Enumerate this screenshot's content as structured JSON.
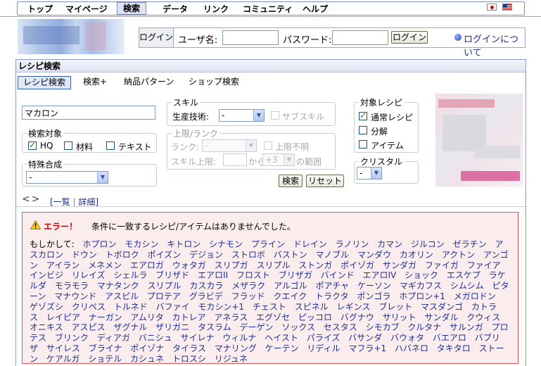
{
  "nav": {
    "items": [
      "トップ",
      "マイページ",
      "検索",
      "データ",
      "リンク",
      "コミュニティ",
      "ヘルプ"
    ],
    "active": "検索"
  },
  "login": {
    "tag": "ログイン",
    "username_label": "ユーザ名:",
    "password_label": "パスワード:",
    "button": "ログイン",
    "about": "ログインについて"
  },
  "panel": {
    "title": "レシピ検索",
    "tabs": [
      "レシピ検索",
      "検索+",
      "納品パターン",
      "ショップ検索"
    ],
    "active_tab": "レシピ検索"
  },
  "search": {
    "keyword": "マカロン",
    "target_legend": "検索対象",
    "targets": [
      {
        "label": "HQ",
        "checked": true
      },
      {
        "label": "材料",
        "checked": false
      },
      {
        "label": "テキスト",
        "checked": false
      }
    ],
    "special_legend": "特殊合成",
    "special_value": "-"
  },
  "skill": {
    "legend": "スキル",
    "tech_label": "生産技術:",
    "tech_value": "-",
    "subskill_label": "サブスキル"
  },
  "limit": {
    "legend": "上限/ランク",
    "rank_label": "ランク:",
    "rank_value": "-",
    "unknown_label": "上限不明",
    "skill_cap_label": "スキル上限:",
    "from_label": "から",
    "range_value": "+3",
    "range_label": "の範囲"
  },
  "actions": {
    "search": "検索",
    "reset": "リセット"
  },
  "recipe_type": {
    "legend": "対象レシピ",
    "items": [
      {
        "label": "通常レシピ",
        "checked": true
      },
      {
        "label": "分解",
        "checked": false
      },
      {
        "label": "アイテム",
        "checked": false
      }
    ]
  },
  "crystal": {
    "legend": "クリスタル",
    "value": "-"
  },
  "pager": {
    "arrows": "<>",
    "list": "[一覧",
    "sep": "|",
    "detail": "詳細]"
  },
  "error": {
    "title": "エラー！",
    "message": "条件に一致するレシピ/アイテムはありませんでした。",
    "maybe": "もしかして:",
    "suggestions": [
      "ホプロン",
      "モカシン",
      "キトロン",
      "シナモン",
      "プライン",
      "ドレイン",
      "ラノリン",
      "カマン",
      "ジルコン",
      "ゼラチン",
      "アスカロン",
      "ドウン",
      "トボロク",
      "ポイズン",
      "デジョン",
      "ストロボ",
      "バストン",
      "マノブル",
      "マンダウ",
      "カオリン",
      "アクトン",
      "アンゴン",
      "アイラン",
      "メネメン",
      "エアロガ",
      "ウォタガ",
      "スリプガ",
      "スリプル",
      "ストンガ",
      "ポイゾガ",
      "サンダガ",
      "ファイガ",
      "ファイア",
      "インビジ",
      "リレイズ",
      "シェルラ",
      "ブリザド",
      "エアロII",
      "フロスト",
      "ブリザガ",
      "バインド",
      "エアロIV",
      "ショック",
      "エスケプ",
      "ラケルダ",
      "モラモラ",
      "マナタンク",
      "スリプル",
      "カスカラ",
      "メザラク",
      "アルゴル",
      "ポアチャ",
      "ケーソン",
      "マギカフス",
      "シムシム",
      "ピターン",
      "マナウンド",
      "アスピル",
      "プロテア",
      "グラビデ",
      "フラッド",
      "クエイク",
      "トラクタ",
      "ポンゴラ",
      "ホプロン+1",
      "メガロドン",
      "ゲゾズシ",
      "クリペス",
      "トルネド",
      "バファイ",
      "モカシン+1",
      "チェスト",
      "スピネル",
      "レギンス",
      "ブレット",
      "マスダンゴ",
      "カトラス",
      "レイピア",
      "ナーガン",
      "アムリタ",
      "カトレア",
      "アネラス",
      "エグゾセ",
      "ピッコロ",
      "バグナウ",
      "サリット",
      "サンダル",
      "クウィス",
      "オニキス",
      "アスピス",
      "ザグナル",
      "ザリガニ",
      "タスラム",
      "デーゲン",
      "ソックス",
      "セスタス",
      "シモカブ",
      "クルタナ",
      "サルンガ",
      "プロテス",
      "ブリンク",
      "ディアガ",
      "バニシュ",
      "サイレナ",
      "ウィルナ",
      "ヘイスト",
      "パライズ",
      "バサンダ",
      "バウォタ",
      "バエアロ",
      "バブリザ",
      "サイレス",
      "ブライナ",
      "ポイゾナ",
      "タイラス",
      "マナリング",
      "ケーテン",
      "リディル",
      "マフラ+1",
      "ハバネロ",
      "タキタロ",
      "ストーン",
      "ケアルガ",
      "ショテル",
      "カシュネ",
      "トロスシ",
      "リジュネ"
    ]
  },
  "colors": {
    "nav_border": "#7f8fb5",
    "link": "#1a2f93",
    "error_red": "#d10000",
    "error_bg": "#fbeded",
    "active_tab_bg": "#dfe8fb"
  },
  "icons": {
    "warning": "warning-icon",
    "about": "info-bullet-icon",
    "flags": [
      "japan-flag-icon",
      "us-flag-icon"
    ],
    "pager": "prev-next-arrows-icon"
  }
}
